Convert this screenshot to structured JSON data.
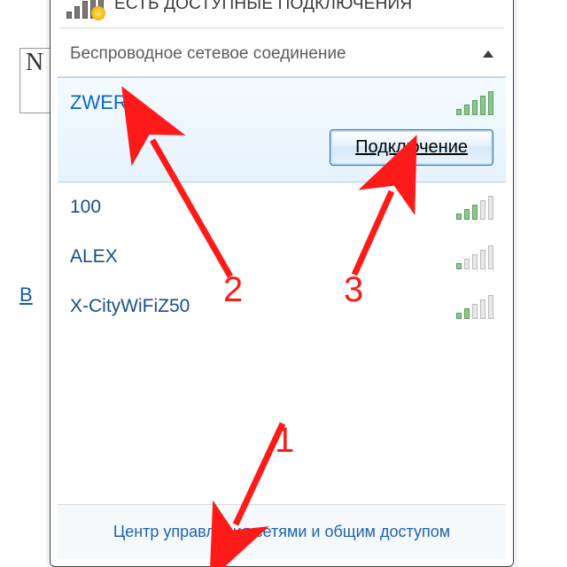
{
  "status": {
    "text": "ЕСТЬ ДОСТУПНЫЕ ПОДКЛЮЧЕНИЯ"
  },
  "category": {
    "title": "Беспроводное сетевое соединение"
  },
  "networks": [
    {
      "name": "ZWER",
      "strength": 5,
      "selected": true
    },
    {
      "name": "100",
      "strength": 3,
      "selected": false
    },
    {
      "name": "ALEX",
      "strength": 1,
      "selected": false
    },
    {
      "name": "X-CityWiFiZ50",
      "strength": 2,
      "selected": false
    }
  ],
  "connect_button": "Подключение",
  "footer_link": "Центр управления сетями и общим доступом",
  "annotations": {
    "a1": "1",
    "a2": "2",
    "a3": "3"
  },
  "bg": {
    "letter": "N",
    "link_fragment": "В"
  }
}
